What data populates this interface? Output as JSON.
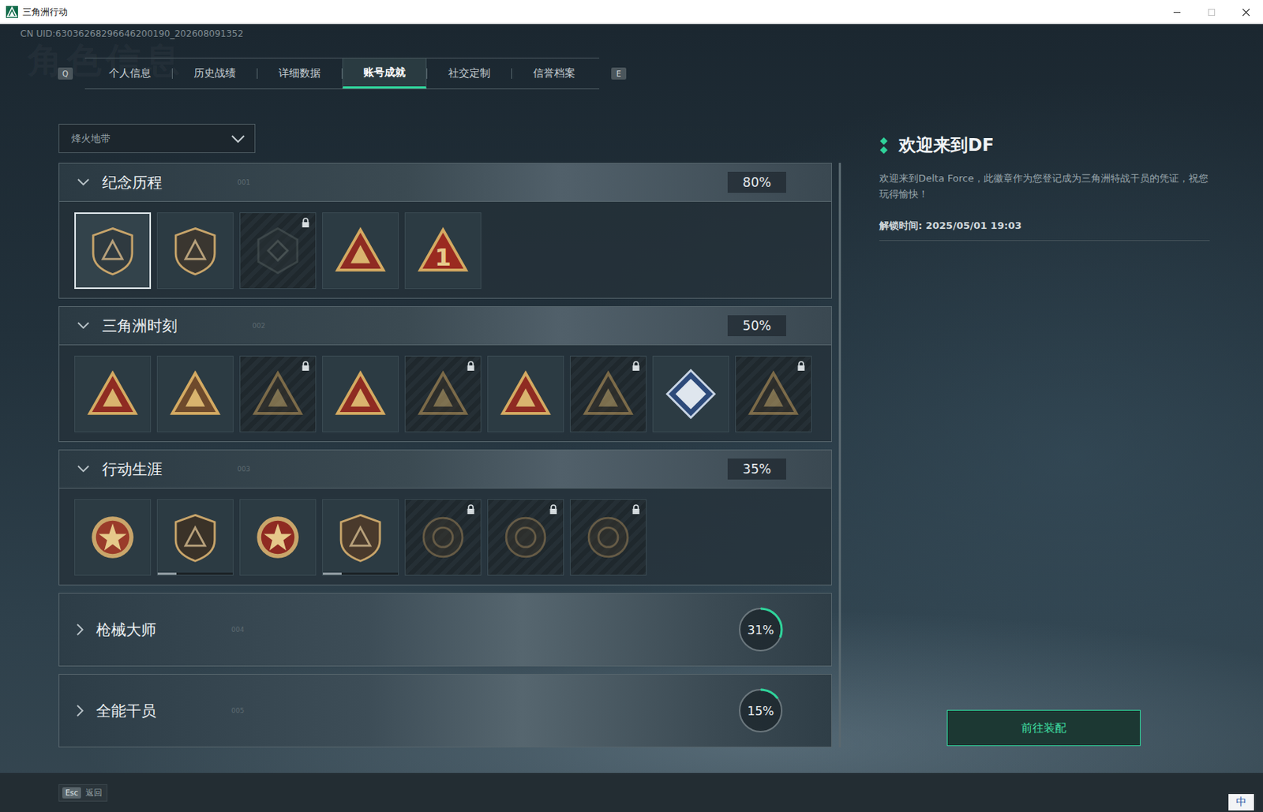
{
  "window": {
    "title": "三角洲行动"
  },
  "uid": "CN UID:63036268296646200190_202608091352",
  "watermark": "角色信息",
  "tab_keys": {
    "prev": "Q",
    "next": "E"
  },
  "tabs": [
    {
      "label": "个人信息",
      "selected": false
    },
    {
      "label": "历史战绩",
      "selected": false
    },
    {
      "label": "详细数据",
      "selected": false
    },
    {
      "label": "账号成就",
      "selected": true
    },
    {
      "label": "社交定制",
      "selected": false
    },
    {
      "label": "信誉档案",
      "selected": false
    }
  ],
  "mode_select": {
    "value": "烽火地带"
  },
  "sections": [
    {
      "title": "纪念历程",
      "code": "001",
      "percent": "80%",
      "expanded": true,
      "badges": [
        {
          "kind": "shield",
          "color": "#2f3a40",
          "locked": false,
          "selected": true
        },
        {
          "kind": "shield",
          "color": "#3a3630",
          "locked": false,
          "selected": false
        },
        {
          "kind": "hex",
          "color": "#2a3236",
          "locked": true,
          "selected": false
        },
        {
          "kind": "triangle",
          "color": "#8f2b22",
          "locked": false,
          "selected": false
        },
        {
          "kind": "triangle",
          "color": "#9a2a20",
          "locked": false,
          "selected": false,
          "glyph": "1"
        }
      ]
    },
    {
      "title": "三角洲时刻",
      "code": "002",
      "percent": "50%",
      "expanded": true,
      "badges": [
        {
          "kind": "triangle",
          "color": "#8f2b22",
          "locked": false,
          "selected": false
        },
        {
          "kind": "triangle",
          "color": "#6e4a2c",
          "locked": false,
          "selected": false
        },
        {
          "kind": "triangle",
          "color": "#3a3228",
          "locked": true,
          "selected": false
        },
        {
          "kind": "triangle",
          "color": "#8f2b22",
          "locked": false,
          "selected": false
        },
        {
          "kind": "triangle",
          "color": "#3a3228",
          "locked": true,
          "selected": false
        },
        {
          "kind": "triangle",
          "color": "#8f2b22",
          "locked": false,
          "selected": false
        },
        {
          "kind": "triangle",
          "color": "#3a3228",
          "locked": true,
          "selected": false
        },
        {
          "kind": "diamond",
          "color": "#dfe6ee",
          "locked": false,
          "selected": false
        },
        {
          "kind": "triangle",
          "color": "#3a3228",
          "locked": true,
          "selected": false
        }
      ]
    },
    {
      "title": "行动生涯",
      "code": "003",
      "percent": "35%",
      "expanded": true,
      "badges": [
        {
          "kind": "medal",
          "color": "#9a3b2a",
          "locked": false,
          "selected": false
        },
        {
          "kind": "shield",
          "color": "#3a3228",
          "locked": false,
          "selected": false,
          "level": 0.25
        },
        {
          "kind": "medal",
          "color": "#8f2b22",
          "locked": false,
          "selected": false
        },
        {
          "kind": "shield",
          "color": "#4a3a2c",
          "locked": false,
          "selected": false,
          "level": 0.25
        },
        {
          "kind": "round",
          "color": "#3a352c",
          "locked": true,
          "selected": false
        },
        {
          "kind": "round",
          "color": "#3a352c",
          "locked": true,
          "selected": false
        },
        {
          "kind": "round",
          "color": "#3a352c",
          "locked": true,
          "selected": false
        }
      ]
    },
    {
      "title": "枪械大师",
      "code": "004",
      "percent": "31%",
      "expanded": false,
      "level": 0.31
    },
    {
      "title": "全能干员",
      "code": "005",
      "percent": "15%",
      "expanded": false,
      "level": 0.15
    }
  ],
  "detail": {
    "title": "欢迎来到DF",
    "description": "欢迎来到Delta Force，此徽章作为您登记成为三角洲特战干员的凭证，祝您玩得愉快！",
    "unlock": "解锁时间: 2025/05/01 19:03",
    "button": "前往装配"
  },
  "footer": {
    "key": "Esc",
    "label": "返回"
  },
  "ime": "中"
}
